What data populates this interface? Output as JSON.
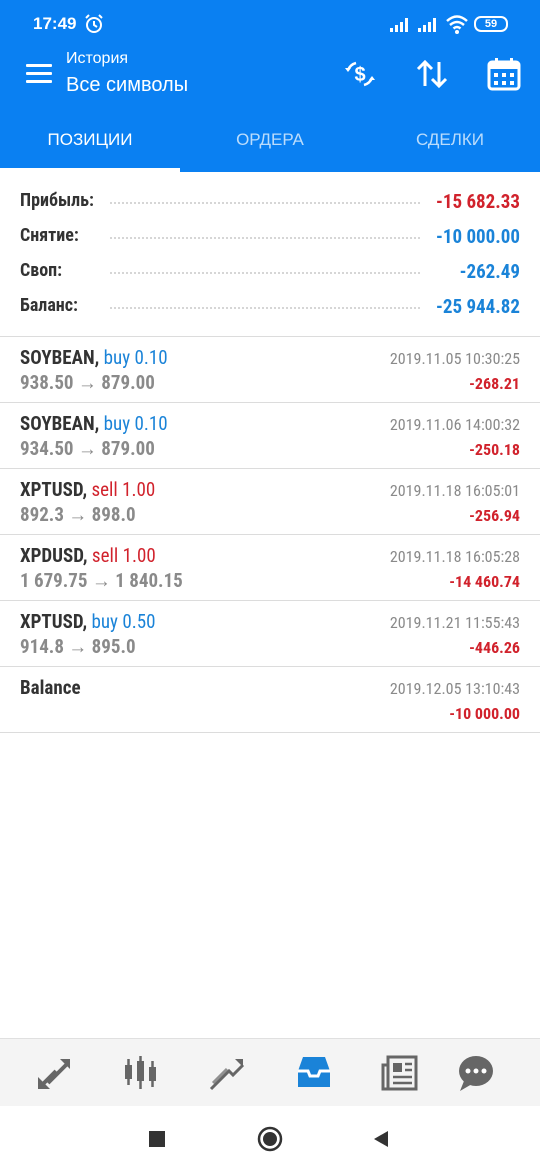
{
  "status_bar": {
    "time": "17:49",
    "battery": "59",
    "icons": [
      "alarm-icon",
      "signal-icon",
      "signal-icon",
      "wifi-icon",
      "battery-icon"
    ]
  },
  "app_bar": {
    "subtitle": "История",
    "title": "Все символы",
    "actions": [
      "currency-exchange-icon",
      "sort-icon",
      "calendar-icon"
    ],
    "accent_color": "#0a80f2"
  },
  "tabs": [
    {
      "label": "ПОЗИЦИИ",
      "active": true
    },
    {
      "label": "ОРДЕРА",
      "active": false
    },
    {
      "label": "СДЕЛКИ",
      "active": false
    }
  ],
  "summary": [
    {
      "label": "Прибыль:",
      "value": "-15 682.33",
      "color": "#d1222c"
    },
    {
      "label": "Снятие:",
      "value": "-10 000.00",
      "color": "#1a83d8"
    },
    {
      "label": "Своп:",
      "value": "-262.49",
      "color": "#1a83d8"
    },
    {
      "label": "Баланс:",
      "value": "-25 944.82",
      "color": "#1a83d8"
    }
  ],
  "deals": [
    {
      "symbol": "SOYBEAN,",
      "side": "buy 0.10",
      "side_color": "#1a83d8",
      "prices": "938.50 → 879.00",
      "time": "2019.11.05 10:30:25",
      "profit": "-268.21"
    },
    {
      "symbol": "SOYBEAN,",
      "side": "buy 0.10",
      "side_color": "#1a83d8",
      "prices": "934.50 → 879.00",
      "time": "2019.11.06 14:00:32",
      "profit": "-250.18"
    },
    {
      "symbol": "XPTUSD,",
      "side": "sell 1.00",
      "side_color": "#d1222c",
      "prices": "892.3 → 898.0",
      "time": "2019.11.18 16:05:01",
      "profit": "-256.94"
    },
    {
      "symbol": "XPDUSD,",
      "side": "sell 1.00",
      "side_color": "#d1222c",
      "prices": "1 679.75 → 1 840.15",
      "time": "2019.11.18 16:05:28",
      "profit": "-14 460.74"
    },
    {
      "symbol": "XPTUSD,",
      "side": "buy 0.50",
      "side_color": "#1a83d8",
      "prices": "914.8 → 895.0",
      "time": "2019.11.21 11:55:43",
      "profit": "-446.26"
    },
    {
      "symbol": "Balance",
      "side": "",
      "side_color": "#1a83d8",
      "prices": "",
      "time": "2019.12.05 13:10:43",
      "profit": "-10 000.00"
    }
  ],
  "bottom_nav": [
    {
      "icon": "quotes-icon",
      "active": false
    },
    {
      "icon": "candlestick-chart-icon",
      "active": false
    },
    {
      "icon": "trade-icon",
      "active": false
    },
    {
      "icon": "history-inbox-icon",
      "active": true
    },
    {
      "icon": "news-icon",
      "active": false
    },
    {
      "icon": "chat-icon",
      "active": false
    }
  ],
  "system_nav": [
    "recents-icon",
    "home-icon",
    "back-icon"
  ]
}
